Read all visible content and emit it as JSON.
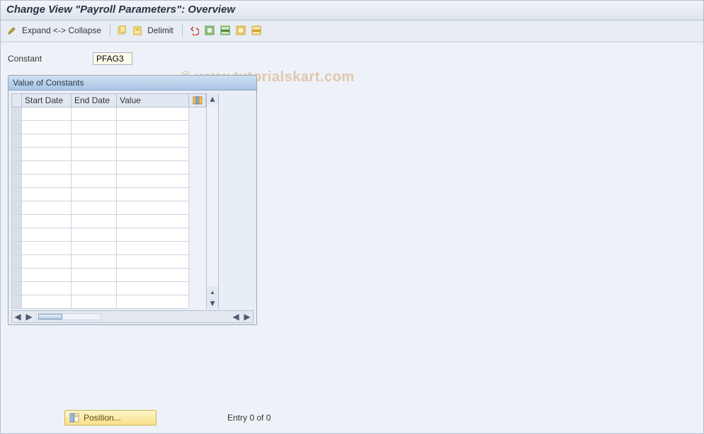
{
  "title": "Change View \"Payroll Parameters\": Overview",
  "toolbar": {
    "expand": "Expand <-> Collapse",
    "delimit": "Delimit"
  },
  "field": {
    "label": "Constant",
    "value": "PFAG3"
  },
  "panel": {
    "title": "Value of Constants",
    "columns": {
      "start": "Start Date",
      "end": "End Date",
      "value": "Value"
    },
    "rows": [
      {
        "start": "",
        "end": "",
        "value": ""
      },
      {
        "start": "",
        "end": "",
        "value": ""
      },
      {
        "start": "",
        "end": "",
        "value": ""
      },
      {
        "start": "",
        "end": "",
        "value": ""
      },
      {
        "start": "",
        "end": "",
        "value": ""
      },
      {
        "start": "",
        "end": "",
        "value": ""
      },
      {
        "start": "",
        "end": "",
        "value": ""
      },
      {
        "start": "",
        "end": "",
        "value": ""
      },
      {
        "start": "",
        "end": "",
        "value": ""
      },
      {
        "start": "",
        "end": "",
        "value": ""
      },
      {
        "start": "",
        "end": "",
        "value": ""
      },
      {
        "start": "",
        "end": "",
        "value": ""
      },
      {
        "start": "",
        "end": "",
        "value": ""
      },
      {
        "start": "",
        "end": "",
        "value": ""
      },
      {
        "start": "",
        "end": "",
        "value": ""
      }
    ]
  },
  "footer": {
    "position_btn": "Position...",
    "entry_text": "Entry 0 of 0"
  },
  "watermark": "© www.tutorialskart.com",
  "icons": {
    "pencil": "pencil-icon",
    "copy": "copy-icon",
    "clipboard": "clipboard-icon",
    "undo": "undo-icon",
    "sel1": "select-all-icon",
    "sel2": "select-block-icon",
    "desel1": "deselect-all-icon",
    "desel2": "deselect-block-icon",
    "settings": "table-settings-icon"
  }
}
